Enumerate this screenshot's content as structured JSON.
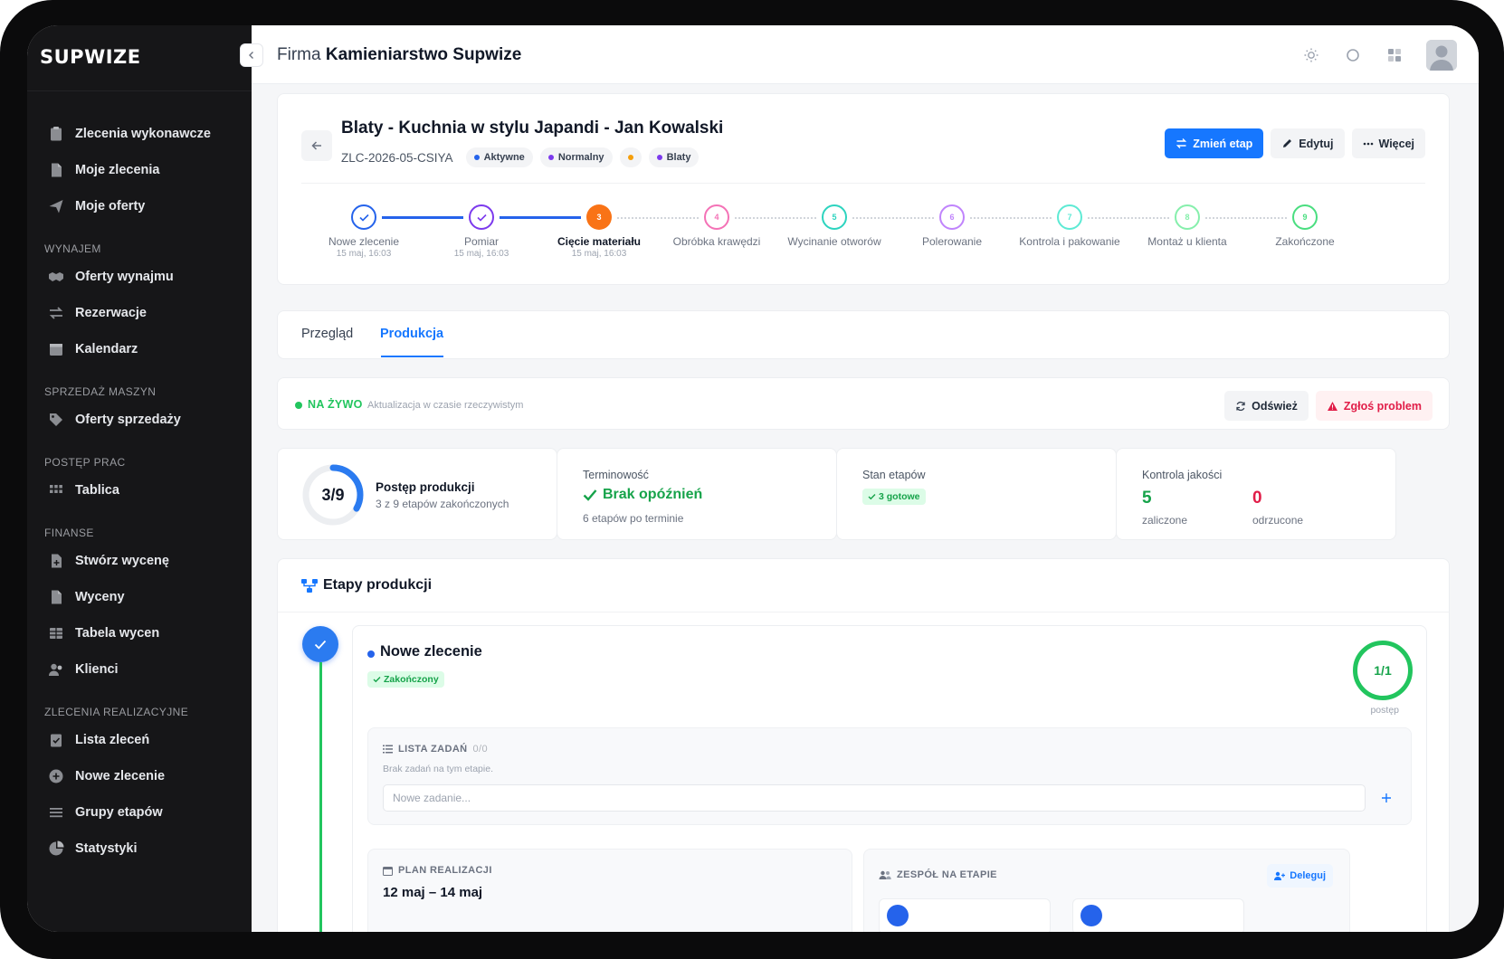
{
  "brand": {
    "logo": "SUPWIZE"
  },
  "sidebar": {
    "items_top": [
      {
        "label": "Zlecenia wykonawcze",
        "icon": "clipboard-icon"
      },
      {
        "label": "Moje zlecenia",
        "icon": "document-icon"
      },
      {
        "label": "Moje oferty",
        "icon": "send-icon"
      }
    ],
    "sections": [
      {
        "title": "WYNAJEM",
        "items": [
          {
            "label": "Oferty wynajmu",
            "icon": "handshake-icon"
          },
          {
            "label": "Rezerwacje",
            "icon": "swap-icon"
          },
          {
            "label": "Kalendarz",
            "icon": "calendar-icon"
          }
        ]
      },
      {
        "title": "SPRZEDAŻ MASZYN",
        "items": [
          {
            "label": "Oferty sprzedaży",
            "icon": "tag-icon"
          }
        ]
      },
      {
        "title": "POSTĘP PRAC",
        "items": [
          {
            "label": "Tablica",
            "icon": "grid-icon"
          }
        ]
      },
      {
        "title": "FINANSE",
        "items": [
          {
            "label": "Stwórz wycenę",
            "icon": "document-plus-icon"
          },
          {
            "label": "Wyceny",
            "icon": "document-icon"
          },
          {
            "label": "Tabela wycen",
            "icon": "table-icon"
          },
          {
            "label": "Klienci",
            "icon": "users-icon"
          }
        ]
      },
      {
        "title": "ZLECENIA REALIZACYJNE",
        "items": [
          {
            "label": "Lista zleceń",
            "icon": "clipboard-check-icon"
          },
          {
            "label": "Nowe zlecenie",
            "icon": "plus-circle-icon"
          },
          {
            "label": "Grupy etapów",
            "icon": "list-icon"
          },
          {
            "label": "Statystyki",
            "icon": "pie-chart-icon"
          }
        ]
      }
    ]
  },
  "topbar": {
    "company_prefix": "Firma",
    "company_name": "Kamieniarstwo Supwize"
  },
  "order": {
    "title": "Blaty - Kuchnia w stylu Japandi - Jan Kowalski",
    "code": "ZLC-2026-05-CSIYA",
    "pills": [
      {
        "label": "Aktywne",
        "color": "#2563eb"
      },
      {
        "label": "Normalny",
        "color": "#7c3aed"
      },
      {
        "label": "",
        "color": "#f59e0b"
      },
      {
        "label": "Blaty",
        "color": "#7c3aed"
      }
    ],
    "actions": {
      "change_stage": "Zmień etap",
      "edit": "Edytuj",
      "more": "Więcej"
    }
  },
  "stepper": [
    {
      "n": "1",
      "label": "Nowe zlecenie",
      "date": "15 maj, 16:03",
      "state": "done",
      "color": "#2563eb"
    },
    {
      "n": "2",
      "label": "Pomiar",
      "date": "15 maj, 16:03",
      "state": "done",
      "color": "#7c3aed"
    },
    {
      "n": "3",
      "label": "Cięcie materiału",
      "date": "15 maj, 16:03",
      "state": "current",
      "color": "#f97316"
    },
    {
      "n": "4",
      "label": "Obróbka krawędzi",
      "date": "",
      "state": "todo",
      "color": "#f472b6"
    },
    {
      "n": "5",
      "label": "Wycinanie otworów",
      "date": "",
      "state": "todo",
      "color": "#2dd4bf"
    },
    {
      "n": "6",
      "label": "Polerowanie",
      "date": "",
      "state": "todo",
      "color": "#c084fc"
    },
    {
      "n": "7",
      "label": "Kontrola i pakowanie",
      "date": "",
      "state": "todo",
      "color": "#5eead4"
    },
    {
      "n": "8",
      "label": "Montaż u klienta",
      "date": "",
      "state": "todo",
      "color": "#86efac"
    },
    {
      "n": "9",
      "label": "Zakończone",
      "date": "",
      "state": "todo",
      "color": "#4ade80"
    }
  ],
  "tabs": {
    "overview": "Przegląd",
    "production": "Produkcja"
  },
  "live": {
    "label": "NA ŻYWO",
    "sub": "Aktualizacja w czasie rzeczywistym",
    "refresh": "Odśwież",
    "report": "Zgłoś problem"
  },
  "stats": {
    "progress": {
      "value": "3/9",
      "fraction": 0.3333,
      "title": "Postęp produkcji",
      "sub": "3 z 9 etapów zakończonych"
    },
    "timeliness": {
      "title": "Terminowość",
      "value": "Brak opóźnień",
      "sub": "6 etapów po terminie"
    },
    "stages": {
      "title": "Stan etapów",
      "badge": "3 gotowe"
    },
    "quality": {
      "title": "Kontrola jakości",
      "passed": "5",
      "passed_label": "zaliczone",
      "rejected": "0",
      "rejected_label": "odrzucone"
    }
  },
  "stages": {
    "title": "Etapy produkcji",
    "current": {
      "name": "Nowe zlecenie",
      "status": "Zakończony",
      "progress": "1/1",
      "progress_label": "postęp",
      "tasks_title": "LISTA ZADAŃ",
      "tasks_count": "0/0",
      "tasks_empty": "Brak zadań na tym etapie.",
      "task_placeholder": "Nowe zadanie...",
      "plan_title": "PLAN REALIZACJI",
      "plan_dates": "12 maj – 14 maj",
      "team_title": "ZESPÓŁ NA ETAPIE",
      "delegate": "Deleguj"
    }
  }
}
